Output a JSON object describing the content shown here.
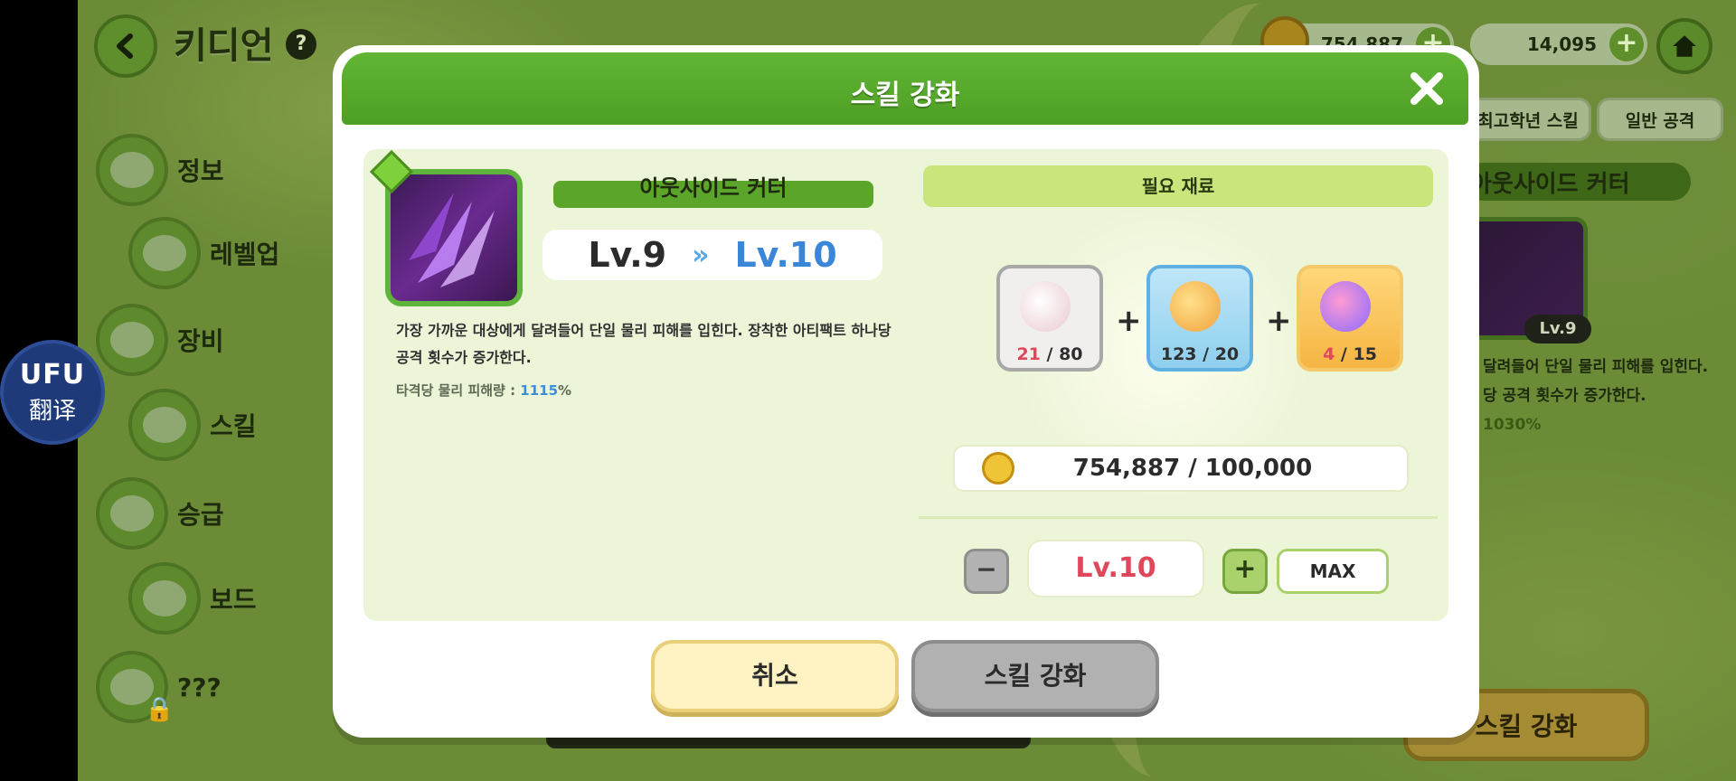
{
  "game": {
    "title": "키디언",
    "help": "?",
    "menu": [
      {
        "label": "정보"
      },
      {
        "label": "레벨업"
      },
      {
        "label": "장비"
      },
      {
        "label": "스킬"
      },
      {
        "label": "승급"
      },
      {
        "label": "보드"
      },
      {
        "label": "???"
      }
    ],
    "currency": {
      "gold": "754,887",
      "gems": "14,095",
      "plus": "+"
    },
    "side_tabs": [
      "최고학년 스킬",
      "일반 공격"
    ],
    "side_skill_name": "아웃사이드 커터",
    "side_level": "Lv.9",
    "side_desc_line1": "달려들어 단일 물리 피해를 입힌다.",
    "side_desc_line2": "당 공격 횟수가 증가한다.",
    "side_stat": "1030%",
    "side_enhance": "스킬 강화"
  },
  "translator": {
    "logo": "UFU",
    "label": "翻译"
  },
  "modal": {
    "title": "스킬 강화",
    "skill": {
      "name": "아웃사이드 커터",
      "level_from": "Lv.9",
      "arrow": "»",
      "level_to": "Lv.10",
      "desc": "가장 가까운 대상에게 달려들어 단일 물리 피해를 입힌다. 장착한 아티팩트 하나당 공격 횟수가 증가한다.",
      "stat_label": "타격당 물리 피해량 : ",
      "stat_value": "1115",
      "stat_unit": "%"
    },
    "materials": {
      "header": "필요 재료",
      "items": [
        {
          "have": "21",
          "need": "/ 80"
        },
        {
          "have": "123",
          "need": "/ 20"
        },
        {
          "have": "4",
          "need": "/ 15"
        }
      ],
      "plus": "+",
      "gold": "754,887 / 100,000"
    },
    "level_control": {
      "minus": "−",
      "value": "Lv.10",
      "plus": "+",
      "max": "MAX"
    },
    "cancel": "취소",
    "enhance": "스킬 강화",
    "colors": {
      "header_green": "#5aae2e",
      "lack_red": "#e0475b",
      "level_blue": "#3a86d8"
    }
  }
}
